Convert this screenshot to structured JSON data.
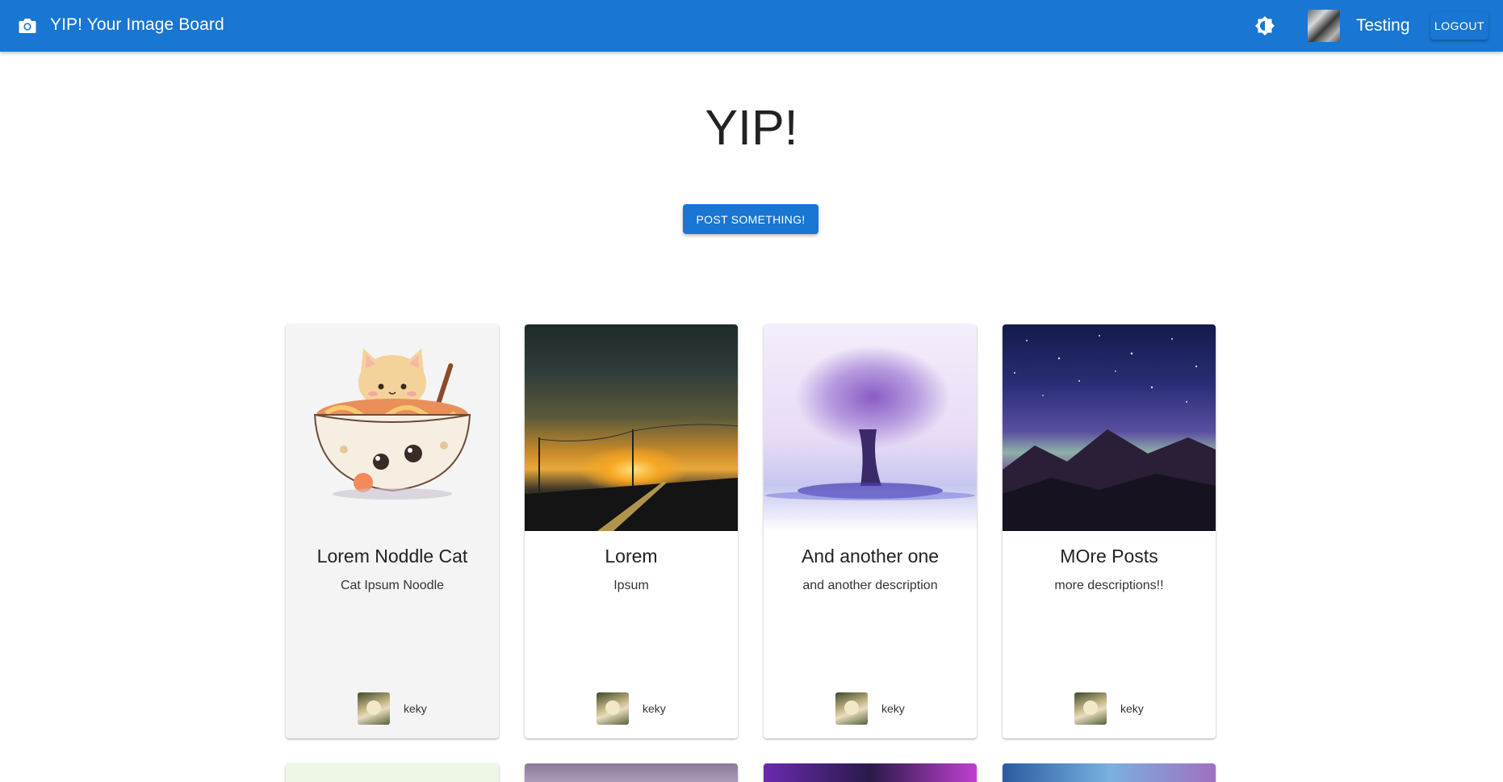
{
  "appbar": {
    "title": "YIP! Your Image Board",
    "username": "Testing",
    "logout_label": "LOGOUT",
    "color": "#1976d2"
  },
  "hero": {
    "title": "YIP!",
    "post_button_label": "POST SOMETHING!"
  },
  "posts": [
    {
      "title": "Lorem Noddle Cat",
      "description": "Cat Ipsum Noodle",
      "author": "keky",
      "image": "cat-noodle-bowl-illustration"
    },
    {
      "title": "Lorem",
      "description": "Ipsum",
      "author": "keky",
      "image": "sunset-road-painting"
    },
    {
      "title": "And another one",
      "description": "and another description",
      "author": "keky",
      "image": "purple-tree-painting"
    },
    {
      "title": "MOre Posts",
      "description": "more descriptions!!",
      "author": "keky",
      "image": "starry-night-mountains"
    }
  ],
  "icons": {
    "camera": "camera-icon",
    "theme": "brightness-icon"
  }
}
